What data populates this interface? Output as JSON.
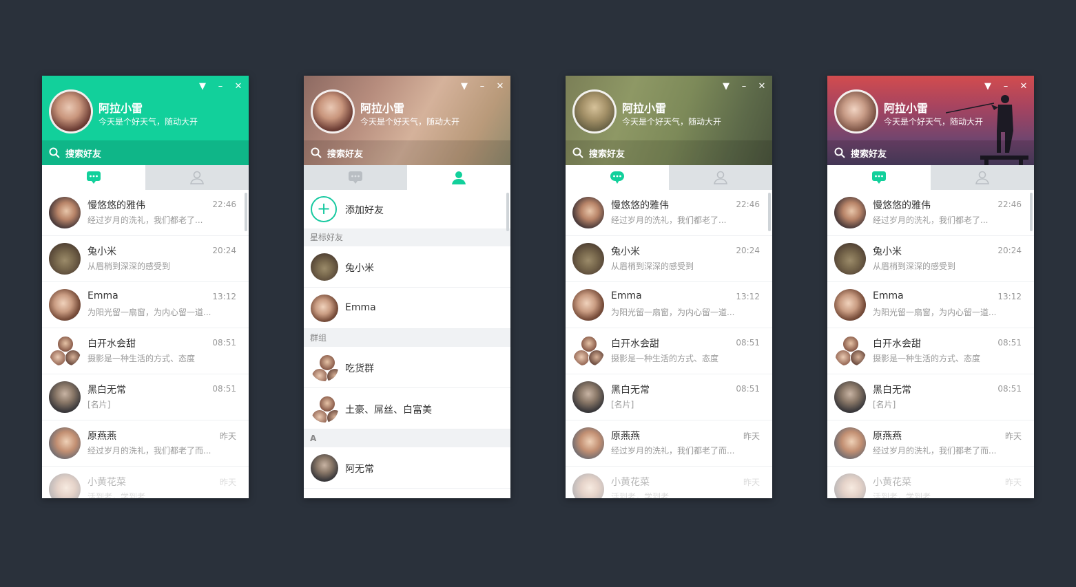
{
  "user": {
    "name": "阿拉小雷",
    "signature": "今天是个好天气，随动大开"
  },
  "window_controls": {
    "dropdown": "▼",
    "minimize": "–",
    "close": "✕"
  },
  "search": {
    "placeholder": "搜索好友"
  },
  "colors": {
    "accent": "#12d09b",
    "background": "#2a313b"
  },
  "chats": [
    {
      "name": "慢悠悠的雅伟",
      "message": "经过岁月的洗礼，我们都老了...",
      "time": "22:46"
    },
    {
      "name": "兔小米",
      "message": "从眉梢到深深的感受到",
      "time": "20:24"
    },
    {
      "name": "Emma",
      "message": "为阳光留一扇窗，为内心留一道...",
      "time": "13:12"
    },
    {
      "name": "白开水会甜",
      "message": "摄影是一种生活的方式、态度",
      "time": "08:51"
    },
    {
      "name": "黑白无常",
      "message": "[名片]",
      "time": "08:51"
    },
    {
      "name": "原燕燕",
      "message": "经过岁月的洗礼，我们都老了而...",
      "time": "昨天"
    },
    {
      "name": "小黄花菜",
      "message": "活到老，学到老",
      "time": "昨天"
    }
  ],
  "contacts": {
    "add_friend": "添加好友",
    "starred_label": "星标好友",
    "starred": [
      "兔小米",
      "Emma"
    ],
    "groups_label": "群组",
    "groups": [
      "吃货群",
      "土豪、屌丝、白富美"
    ],
    "letter_a": "A",
    "a_contacts": [
      "阿无常"
    ]
  }
}
